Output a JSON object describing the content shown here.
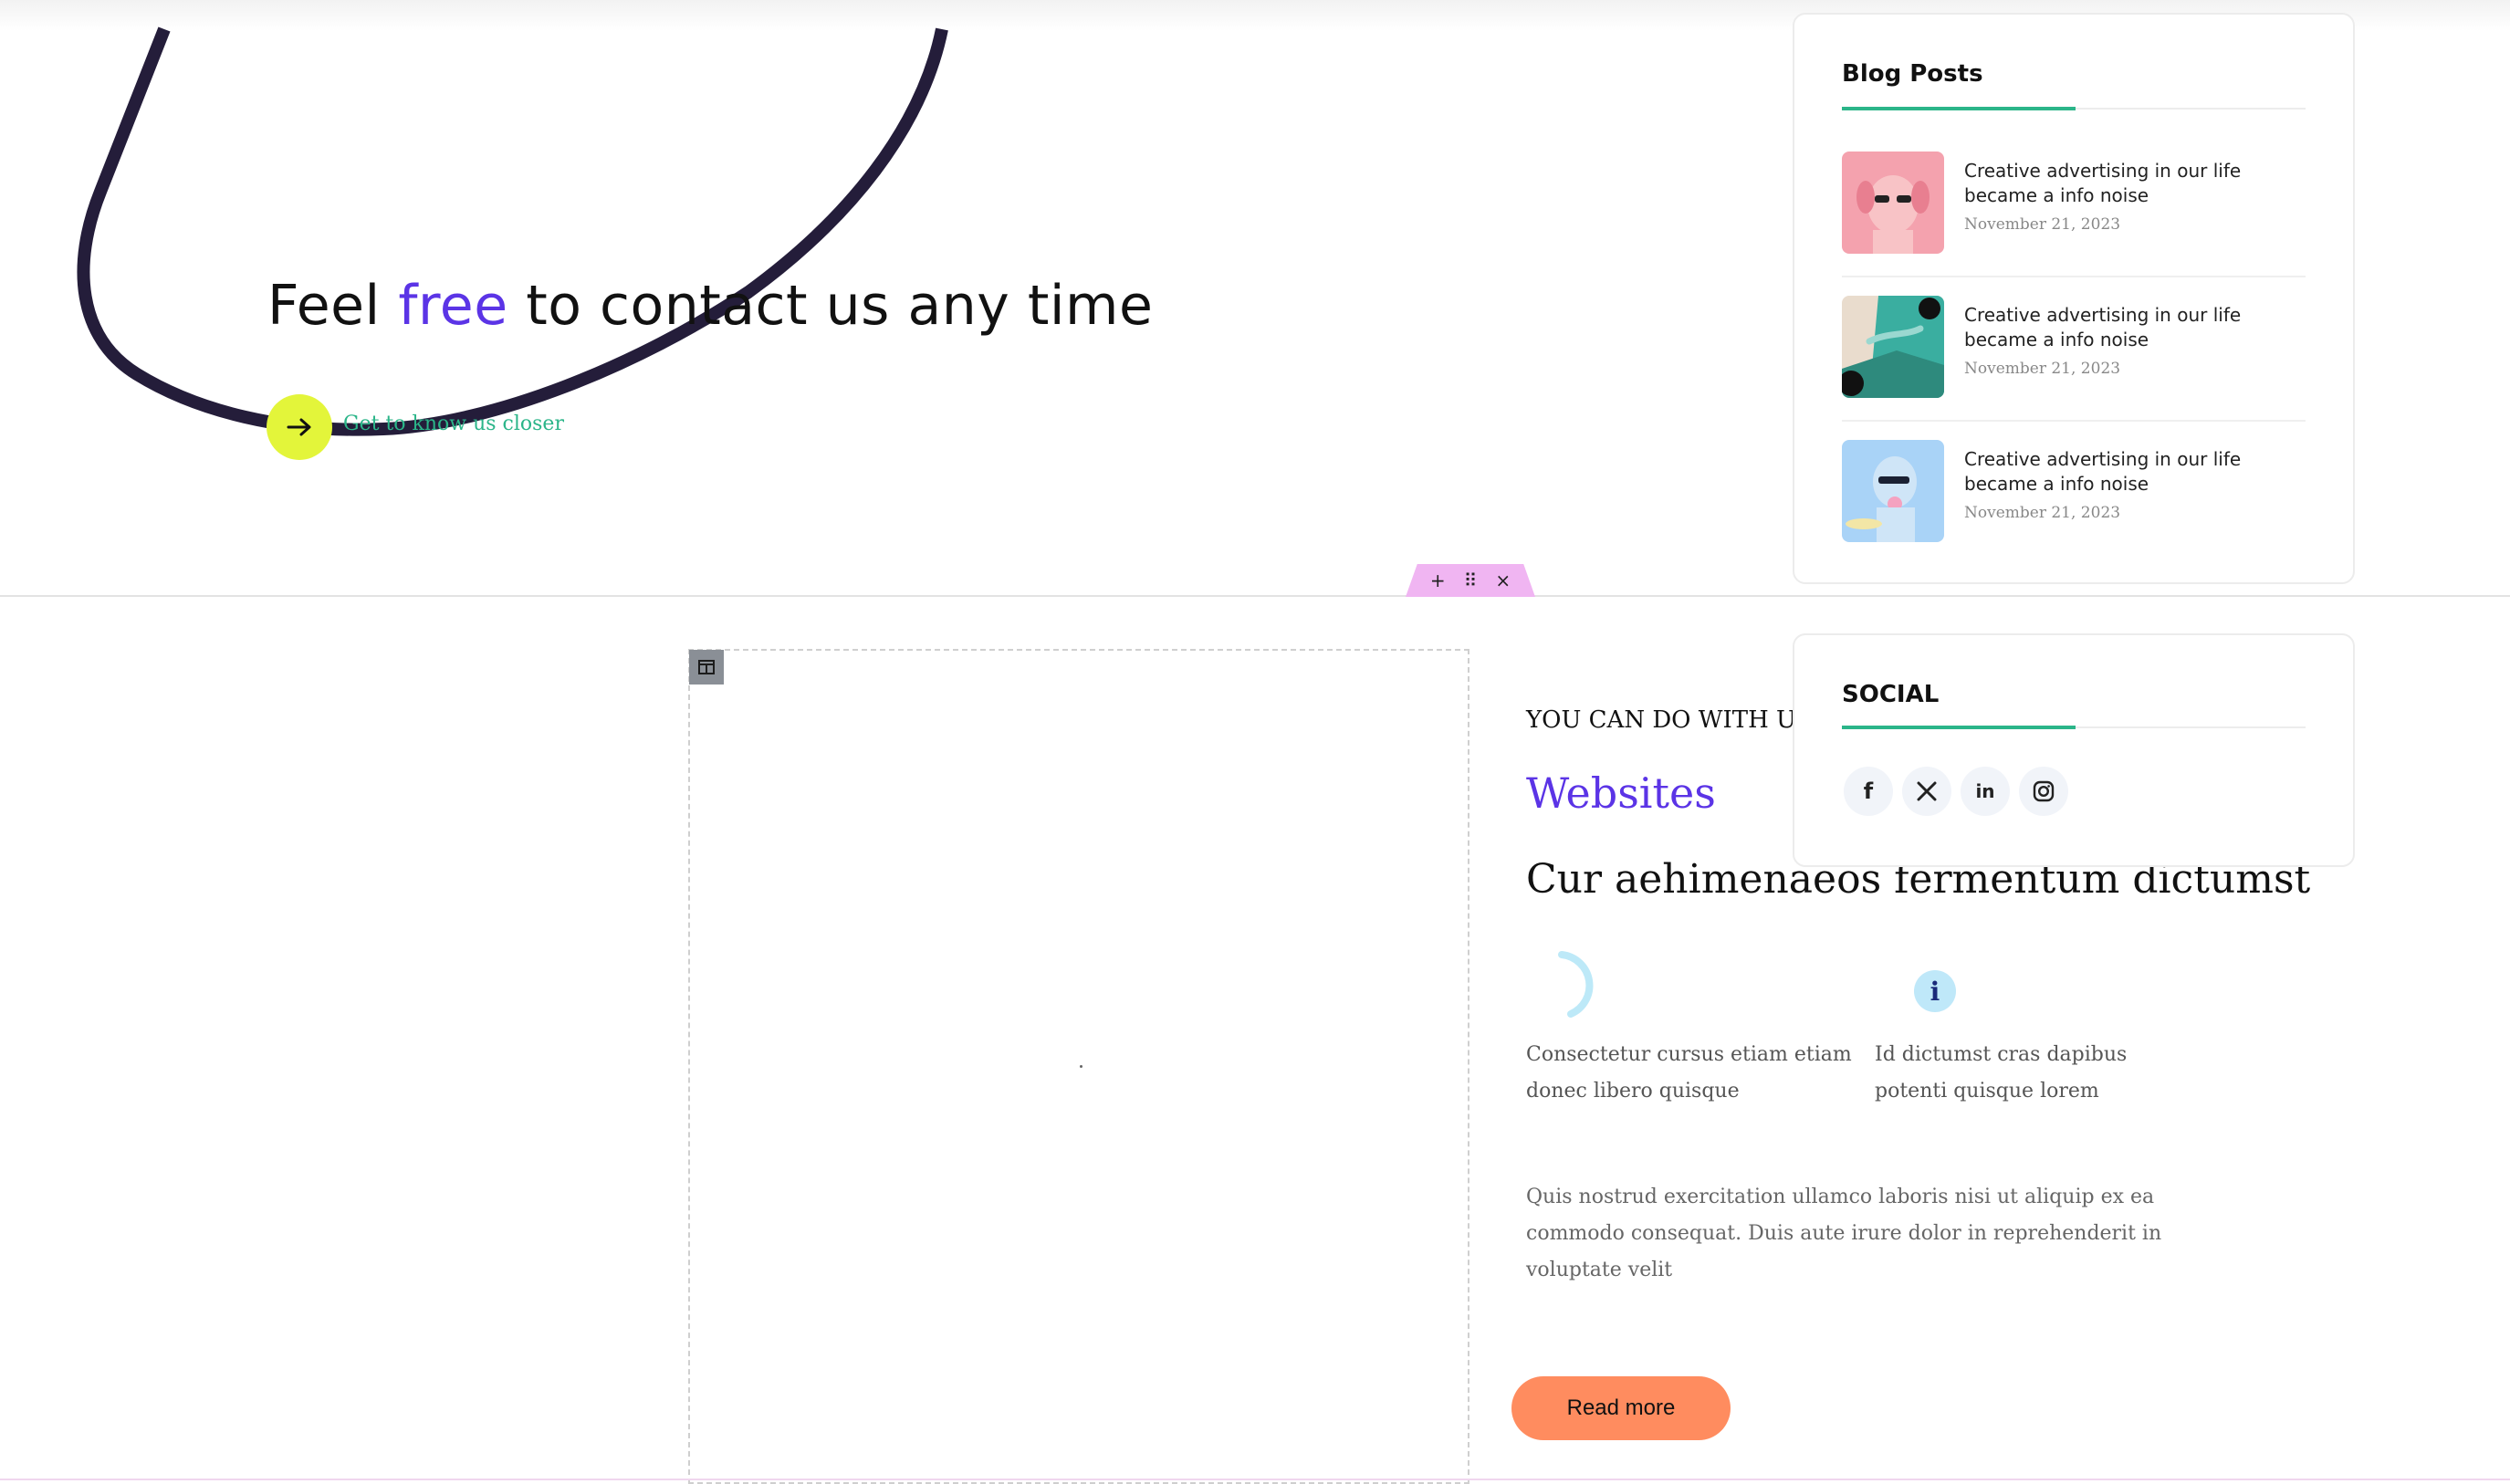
{
  "hero": {
    "heading_before": "Feel ",
    "heading_highlight": "free",
    "heading_after": " to contact us any time",
    "link_text": "Get to know us closer",
    "highlight_color": "#5b34e6",
    "button_color": "#e3f53a",
    "icons": {
      "arrow": "arrow-right-icon"
    }
  },
  "editor_toolbar": {
    "add": "+",
    "drag": "⠿",
    "remove": "×"
  },
  "content": {
    "eyebrow": "YOU CAN DO WITH US",
    "accent_title": "Websites",
    "title": "Cur aehimenaeos fermentum dictumst",
    "features": [
      {
        "icon": "spinner-icon",
        "text": "Consectetur cursus etiam etiam donec libero quisque"
      },
      {
        "icon": "info-icon",
        "symbol": "i",
        "text": "Id dictumst cras dapibus potenti quisque lorem"
      }
    ],
    "paragraph": "Quis nostrud exercitation ullamco laboris nisi ut aliquip ex ea commodo consequat. Duis aute irure dolor in reprehenderit in voluptate velit",
    "read_more": "Read more",
    "read_more_color": "#ff8c5f"
  },
  "sidebar": {
    "blog": {
      "title": "Blog Posts",
      "posts": [
        {
          "title": "Creative advertising in our life became a info noise",
          "date": "November 21, 2023"
        },
        {
          "title": "Creative advertising in our life became a info noise",
          "date": "November 21, 2023"
        },
        {
          "title": "Creative advertising in our life became a info noise",
          "date": "November 21, 2023"
        }
      ]
    },
    "social": {
      "title": "SOCIAL",
      "links": [
        {
          "icon": "facebook-icon",
          "glyph": "f"
        },
        {
          "icon": "x-twitter-icon",
          "glyph": "X"
        },
        {
          "icon": "linkedin-icon",
          "glyph": "in"
        },
        {
          "icon": "instagram-icon",
          "glyph": ""
        }
      ]
    },
    "accent_color": "#2bb589"
  }
}
